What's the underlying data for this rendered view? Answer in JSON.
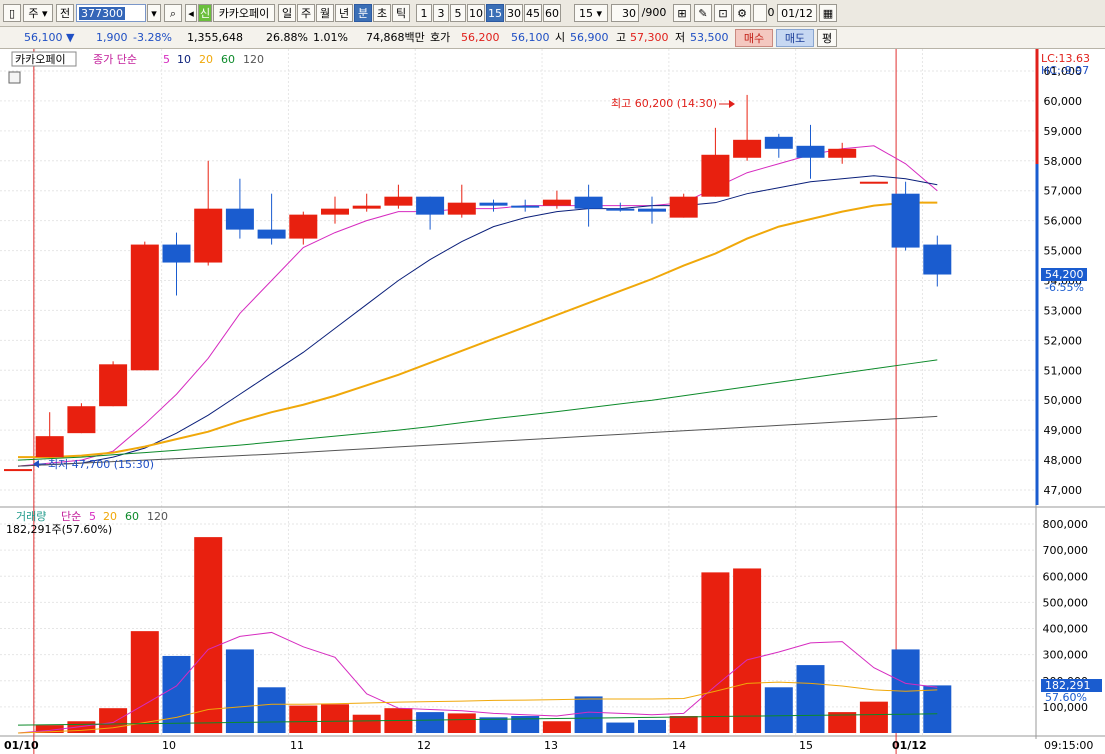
{
  "toolbar": {
    "market": "주",
    "period_prefix": "전",
    "stock_code": "377300",
    "stock_badge": "신",
    "stock_name": "카카오페이",
    "periods": [
      "일",
      "주",
      "월",
      "년",
      "분",
      "초",
      "틱"
    ],
    "selected_period": "분",
    "intervals": [
      "1",
      "3",
      "5",
      "10",
      "15",
      "30",
      "45",
      "60"
    ],
    "selected_interval": "15",
    "interval_select": "15",
    "count_value": "30",
    "count_total": "/900",
    "date_value": "01/12",
    "checkbox_label": "0"
  },
  "quote": {
    "price": "56,100",
    "change_arrow": "▼",
    "change": "1,900",
    "change_pct": "-3.28%",
    "volume": "1,355,648",
    "turnover_pct": "26.88%",
    "extra_pct": "1.01%",
    "trade_value": "74,868백만",
    "ask_label": "호가",
    "ask": "56,200",
    "bid": "56,100",
    "open_label": "시",
    "open": "56,900",
    "high_label": "고",
    "high": "57,300",
    "low_label": "저",
    "low": "53,500",
    "buy_label": "매수",
    "sell_label": "매도",
    "eval_label": "평"
  },
  "colors": {
    "up": "#e8200f",
    "down": "#1a5ccf",
    "ma5": "#d62bc0",
    "ma10": "#0a1f7a",
    "ma20": "#f0a80a",
    "ma60": "#0c8a2a",
    "ma120": "#555555",
    "vline": "#e03030"
  },
  "price_panel": {
    "title": "카카오페이",
    "legend_prefix": "종가 단순",
    "legend_periods": [
      "5",
      "10",
      "20",
      "60",
      "120"
    ],
    "lc": "LC:13.63",
    "hc": "HC:-9.97",
    "current_price": "54,200",
    "current_pct": "-6.55%",
    "max_label": "최고 60,200 (14:30)",
    "min_label": "최저 47,700 (15:30)"
  },
  "volume_panel": {
    "legend_name": "거래량",
    "legend_prefix": "단순",
    "legend_periods": [
      "5",
      "20",
      "60",
      "120"
    ],
    "info": "182,291주(57.60%)",
    "current_value": "182,291",
    "current_pct": "57.60%"
  },
  "x_labels": [
    "01/10",
    "10",
    "11",
    "12",
    "13",
    "14",
    "15",
    "01/12"
  ],
  "time_label": "09:15:00",
  "chart_data": {
    "type": "candlestick",
    "price_axis": {
      "min": 46500,
      "max": 61600,
      "ticks": [
        47000,
        48000,
        49000,
        50000,
        51000,
        52000,
        53000,
        54000,
        55000,
        56000,
        57000,
        58000,
        59000,
        60000,
        61000
      ]
    },
    "volume_axis": {
      "min": 0,
      "max": 850000,
      "ticks": [
        100000,
        200000,
        300000,
        400000,
        500000,
        600000,
        700000,
        800000
      ]
    },
    "candles": [
      {
        "o": 47700,
        "c": 47700,
        "h": 47700,
        "l": 47700,
        "v": 0,
        "up": true
      },
      {
        "o": 48100,
        "c": 48800,
        "h": 49600,
        "l": 48100,
        "v": 30000,
        "up": true
      },
      {
        "o": 48900,
        "c": 49800,
        "h": 49900,
        "l": 48900,
        "v": 45000,
        "up": true
      },
      {
        "o": 49800,
        "c": 51200,
        "h": 51300,
        "l": 49800,
        "v": 95000,
        "up": true
      },
      {
        "o": 51000,
        "c": 55200,
        "h": 55300,
        "l": 51000,
        "v": 390000,
        "up": true
      },
      {
        "o": 55200,
        "c": 54600,
        "h": 55600,
        "l": 53500,
        "v": 295000,
        "up": false
      },
      {
        "o": 54600,
        "c": 56400,
        "h": 58000,
        "l": 54500,
        "v": 750000,
        "up": true
      },
      {
        "o": 56400,
        "c": 55700,
        "h": 57400,
        "l": 55400,
        "v": 320000,
        "up": false
      },
      {
        "o": 55700,
        "c": 55400,
        "h": 56900,
        "l": 55200,
        "v": 175000,
        "up": false
      },
      {
        "o": 55400,
        "c": 56200,
        "h": 56300,
        "l": 55200,
        "v": 105000,
        "up": true
      },
      {
        "o": 56200,
        "c": 56400,
        "h": 56800,
        "l": 55900,
        "v": 110000,
        "up": true
      },
      {
        "o": 56400,
        "c": 56500,
        "h": 56900,
        "l": 56300,
        "v": 70000,
        "up": true
      },
      {
        "o": 56500,
        "c": 56800,
        "h": 57200,
        "l": 56400,
        "v": 95000,
        "up": true
      },
      {
        "o": 56800,
        "c": 56200,
        "h": 56800,
        "l": 55700,
        "v": 80000,
        "up": false
      },
      {
        "o": 56200,
        "c": 56600,
        "h": 57200,
        "l": 56100,
        "v": 75000,
        "up": true
      },
      {
        "o": 56600,
        "c": 56500,
        "h": 56700,
        "l": 56300,
        "v": 60000,
        "up": false
      },
      {
        "o": 56500,
        "c": 56500,
        "h": 56700,
        "l": 56300,
        "v": 65000,
        "up": false
      },
      {
        "o": 56500,
        "c": 56700,
        "h": 57000,
        "l": 56400,
        "v": 45000,
        "up": true
      },
      {
        "o": 56800,
        "c": 56400,
        "h": 57200,
        "l": 55800,
        "v": 140000,
        "up": false
      },
      {
        "o": 56400,
        "c": 56400,
        "h": 56600,
        "l": 56300,
        "v": 40000,
        "up": false
      },
      {
        "o": 56400,
        "c": 56300,
        "h": 56800,
        "l": 55900,
        "v": 50000,
        "up": false
      },
      {
        "o": 56100,
        "c": 56800,
        "h": 56900,
        "l": 56100,
        "v": 65000,
        "up": true
      },
      {
        "o": 56800,
        "c": 58200,
        "h": 59100,
        "l": 56800,
        "v": 615000,
        "up": true
      },
      {
        "o": 58100,
        "c": 58700,
        "h": 60200,
        "l": 58000,
        "v": 630000,
        "up": true
      },
      {
        "o": 58800,
        "c": 58400,
        "h": 58900,
        "l": 58100,
        "v": 175000,
        "up": false
      },
      {
        "o": 58500,
        "c": 58100,
        "h": 59200,
        "l": 57400,
        "v": 260000,
        "up": false
      },
      {
        "o": 58100,
        "c": 58400,
        "h": 58600,
        "l": 57900,
        "v": 80000,
        "up": true
      },
      {
        "o": 57300,
        "c": 57300,
        "h": 57300,
        "l": 57300,
        "v": 120000,
        "up": true
      },
      {
        "o": 56900,
        "c": 55100,
        "h": 57300,
        "l": 55000,
        "v": 320000,
        "up": false
      },
      {
        "o": 55200,
        "c": 54200,
        "h": 55500,
        "l": 53800,
        "v": 182291,
        "up": false
      }
    ],
    "ma": [
      {
        "name": "5",
        "values": [
          47800,
          47900,
          48000,
          48300,
          49200,
          50200,
          51400,
          52900,
          54000,
          55100,
          55600,
          56000,
          56300,
          56300,
          56400,
          56400,
          56500,
          56500,
          56500,
          56500,
          56500,
          56600,
          57100,
          57600,
          57900,
          58200,
          58400,
          58500,
          57900,
          57000
        ]
      },
      {
        "name": "10",
        "values": [
          47800,
          47850,
          47900,
          48100,
          48400,
          48900,
          49500,
          50200,
          50900,
          51600,
          52400,
          53200,
          54000,
          54700,
          55300,
          55800,
          56100,
          56300,
          56400,
          56400,
          56500,
          56500,
          56600,
          56900,
          57100,
          57300,
          57400,
          57500,
          57400,
          57200
        ]
      },
      {
        "name": "20",
        "values": [
          48100,
          48100,
          48150,
          48250,
          48450,
          48700,
          48950,
          49300,
          49600,
          49850,
          50150,
          50500,
          50850,
          51250,
          51650,
          52050,
          52450,
          52850,
          53250,
          53650,
          54050,
          54500,
          54900,
          55400,
          55800,
          56050,
          56300,
          56500,
          56600,
          56600
        ]
      },
      {
        "name": "60",
        "values": [
          48000,
          48050,
          48100,
          48180,
          48250,
          48330,
          48420,
          48500,
          48600,
          48700,
          48800,
          48900,
          49000,
          49120,
          49250,
          49380,
          49500,
          49620,
          49750,
          49880,
          50000,
          50150,
          50300,
          50450,
          50600,
          50750,
          50900,
          51050,
          51200,
          51350
        ]
      },
      {
        "name": "120",
        "values": [
          47800,
          47850,
          47900,
          47950,
          48000,
          48050,
          48100,
          48150,
          48200,
          48260,
          48320,
          48380,
          48440,
          48500,
          48560,
          48620,
          48680,
          48740,
          48800,
          48860,
          48920,
          48980,
          49040,
          49100,
          49160,
          49220,
          49280,
          49340,
          49400,
          49460
        ]
      }
    ],
    "vol_ma": [
      {
        "name": "5",
        "values": [
          0,
          10000,
          25000,
          40000,
          110000,
          180000,
          320000,
          370000,
          385000,
          330000,
          290000,
          150000,
          95000,
          90000,
          85000,
          75000,
          70000,
          65000,
          80000,
          75000,
          70000,
          75000,
          180000,
          280000,
          310000,
          345000,
          350000,
          250000,
          190000,
          175000
        ]
      },
      {
        "name": "20",
        "values": [
          0,
          5000,
          10000,
          20000,
          40000,
          60000,
          90000,
          100000,
          110000,
          110000,
          112000,
          115000,
          118000,
          120000,
          122000,
          125000,
          126000,
          128000,
          130000,
          130000,
          130000,
          132000,
          160000,
          190000,
          195000,
          190000,
          180000,
          165000,
          160000,
          165000
        ]
      }
    ]
  }
}
